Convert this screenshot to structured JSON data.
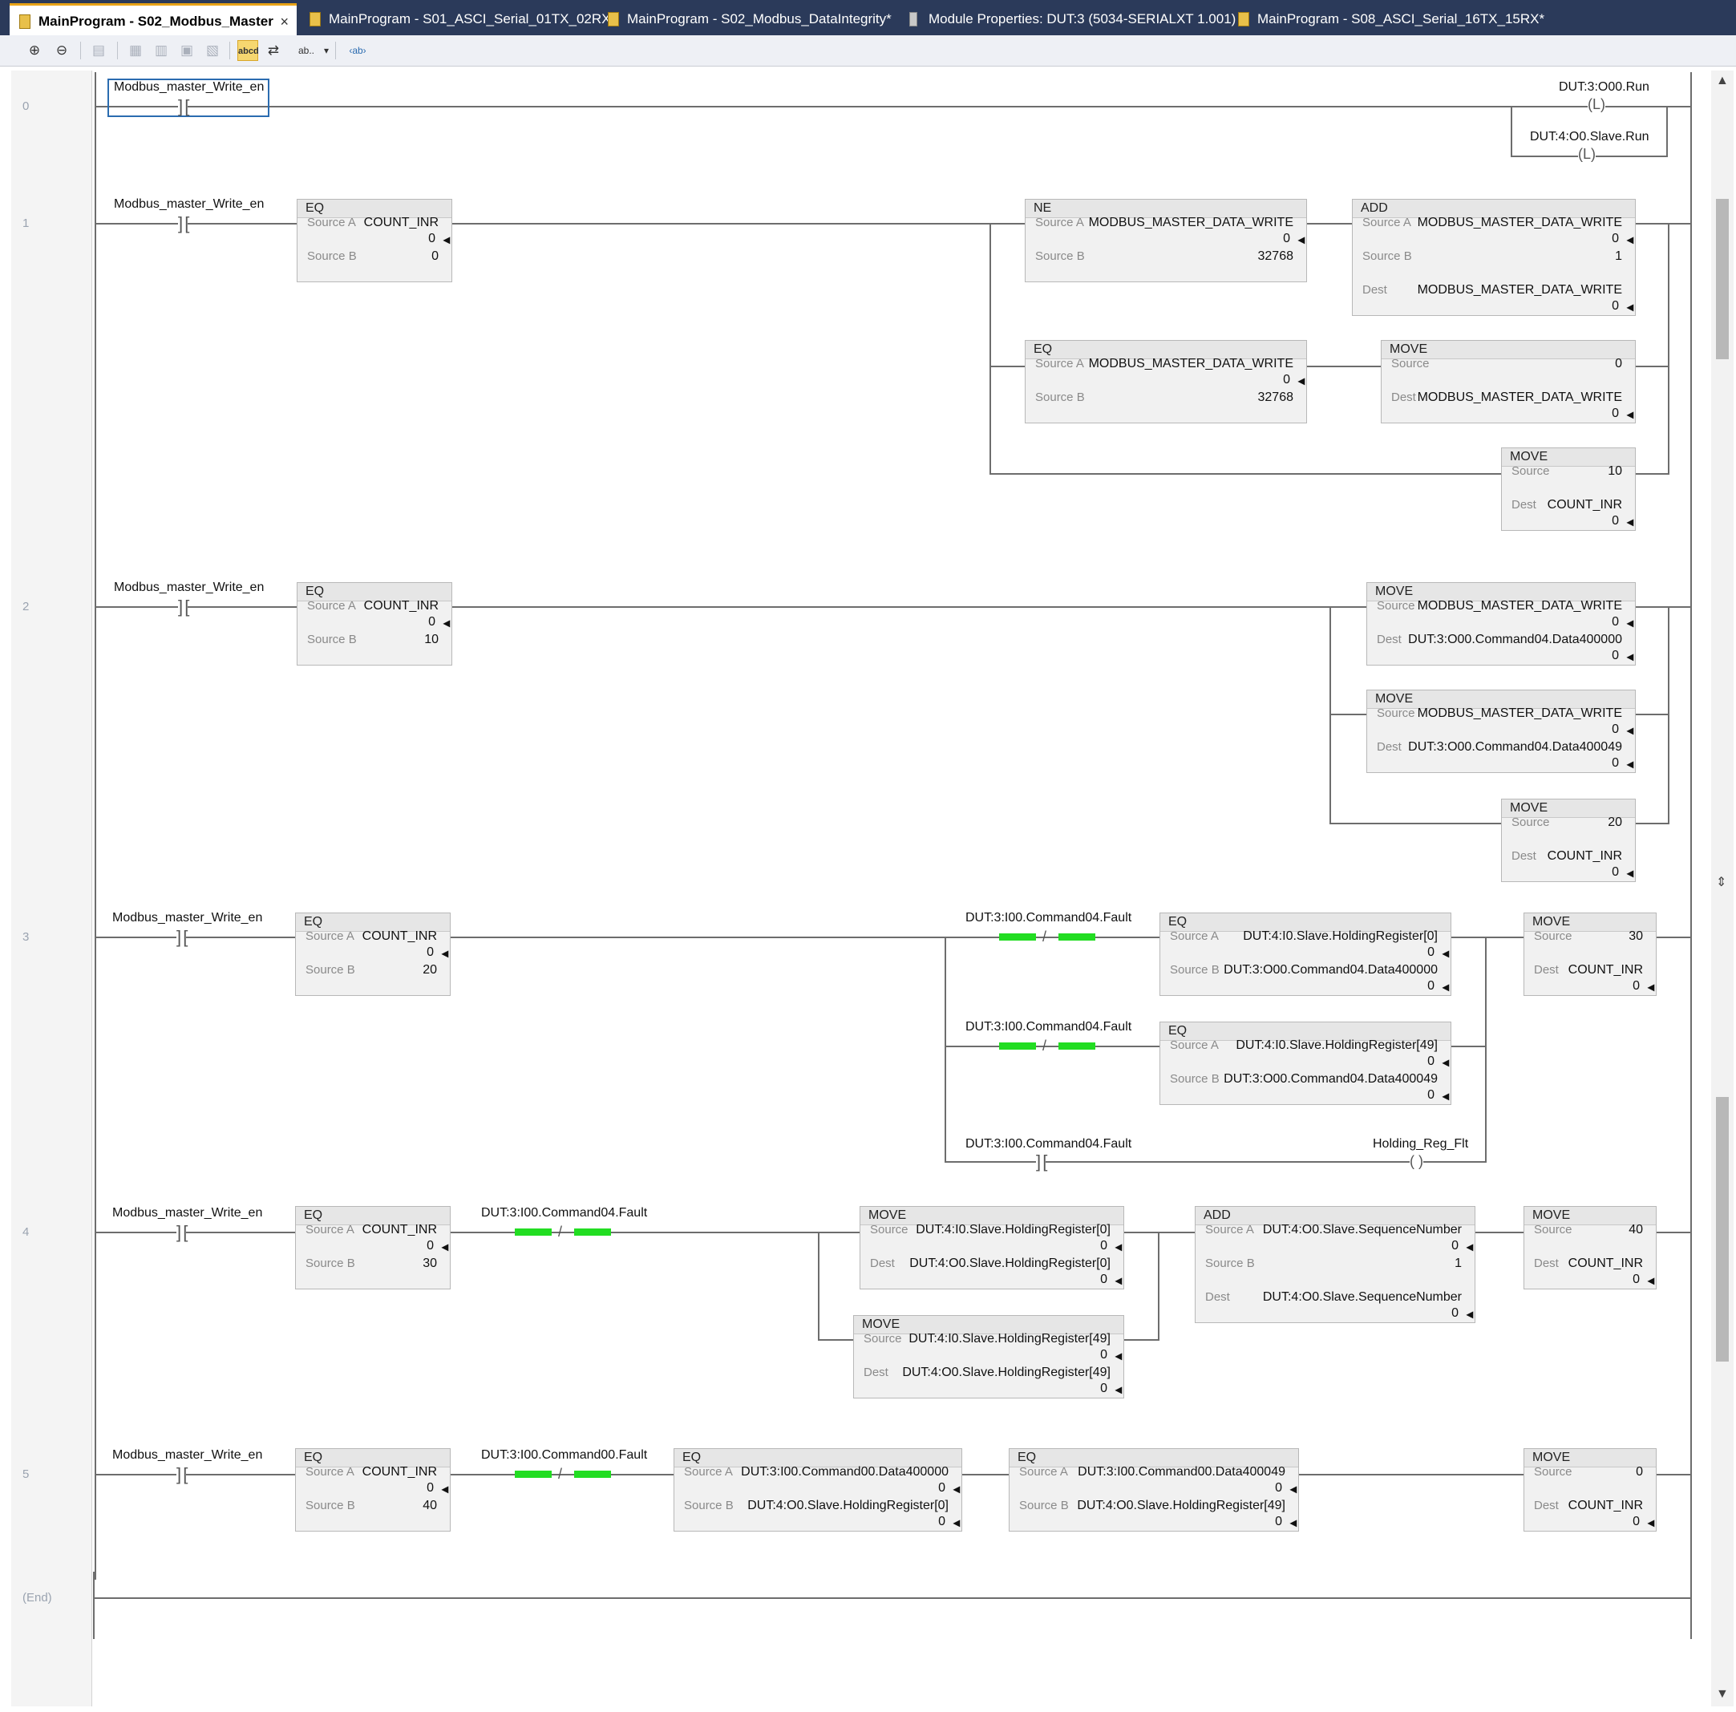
{
  "tabs": [
    {
      "label": "MainProgram - S02_Modbus_Master",
      "active": true,
      "close": "×"
    },
    {
      "label": "MainProgram - S01_ASCI_Serial_01TX_02RX*",
      "active": false
    },
    {
      "label": "MainProgram - S02_Modbus_DataIntegrity*",
      "active": false
    },
    {
      "label": "Module Properties: DUT:3 (5034-SERIALXT 1.001)",
      "active": false
    },
    {
      "label": "MainProgram - S08_ASCI_Serial_16TX_15RX*",
      "active": false
    }
  ],
  "toolbar": {
    "zoom_in": "⊕",
    "zoom_out": "⊖",
    "abcd": "abcd",
    "ab": "ab..",
    "dropdown": "▾",
    "chevron": "‹ab›"
  },
  "rungs": {
    "r0": {
      "num": "0",
      "contact": "Modbus_master_Write_en",
      "coil1": "DUT:3:O00.Run",
      "coil2": "DUT:4:O0.Slave.Run",
      "coil_sym": "(L)"
    },
    "r1": {
      "num": "1",
      "contact": "Modbus_master_Write_en",
      "eq": {
        "title": "EQ",
        "a_lbl": "Source A",
        "a": "COUNT_INR",
        "a_sub": "0",
        "b_lbl": "Source B",
        "b": "0"
      },
      "ne": {
        "title": "NE",
        "a_lbl": "Source A",
        "a": "MODBUS_MASTER_DATA_WRITE",
        "a_sub": "0",
        "b_lbl": "Source B",
        "b": "32768"
      },
      "add": {
        "title": "ADD",
        "a_lbl": "Source A",
        "a": "MODBUS_MASTER_DATA_WRITE",
        "a_sub": "0",
        "b_lbl": "Source B",
        "b": "1",
        "d_lbl": "Dest",
        "d": "MODBUS_MASTER_DATA_WRITE",
        "d_sub": "0"
      },
      "eq2": {
        "title": "EQ",
        "a_lbl": "Source A",
        "a": "MODBUS_MASTER_DATA_WRITE",
        "a_sub": "0",
        "b_lbl": "Source B",
        "b": "32768"
      },
      "mov1": {
        "title": "MOVE",
        "s_lbl": "Source",
        "s": "0",
        "d_lbl": "Dest",
        "d": "MODBUS_MASTER_DATA_WRITE",
        "d_sub": "0"
      },
      "mov2": {
        "title": "MOVE",
        "s_lbl": "Source",
        "s": "10",
        "d_lbl": "Dest",
        "d": "COUNT_INR",
        "d_sub": "0"
      }
    },
    "r2": {
      "num": "2",
      "contact": "Modbus_master_Write_en",
      "eq": {
        "title": "EQ",
        "a_lbl": "Source A",
        "a": "COUNT_INR",
        "a_sub": "0",
        "b_lbl": "Source B",
        "b": "10"
      },
      "mov1": {
        "title": "MOVE",
        "s_lbl": "Source",
        "s": "MODBUS_MASTER_DATA_WRITE",
        "s_sub": "0",
        "d_lbl": "Dest",
        "d": "DUT:3:O00.Command04.Data400000",
        "d_sub": "0"
      },
      "mov2": {
        "title": "MOVE",
        "s_lbl": "Source",
        "s": "MODBUS_MASTER_DATA_WRITE",
        "s_sub": "0",
        "d_lbl": "Dest",
        "d": "DUT:3:O00.Command04.Data400049",
        "d_sub": "0"
      },
      "mov3": {
        "title": "MOVE",
        "s_lbl": "Source",
        "s": "20",
        "d_lbl": "Dest",
        "d": "COUNT_INR",
        "d_sub": "0"
      }
    },
    "r3": {
      "num": "3",
      "contact": "Modbus_master_Write_en",
      "eq": {
        "title": "EQ",
        "a_lbl": "Source A",
        "a": "COUNT_INR",
        "a_sub": "0",
        "b_lbl": "Source B",
        "b": "20"
      },
      "fault1": "DUT:3:I00.Command04.Fault",
      "fault2": "DUT:3:I00.Command04.Fault",
      "fault3": "DUT:3:I00.Command04.Fault",
      "eq2": {
        "title": "EQ",
        "a_lbl": "Source A",
        "a": "DUT:4:I0.Slave.HoldingRegister[0]",
        "a_sub": "0",
        "b_lbl": "Source B",
        "b": "DUT:3:O00.Command04.Data400000",
        "b_sub": "0"
      },
      "eq3": {
        "title": "EQ",
        "a_lbl": "Source A",
        "a": "DUT:4:I0.Slave.HoldingRegister[49]",
        "a_sub": "0",
        "b_lbl": "Source B",
        "b": "DUT:3:O00.Command04.Data400049",
        "b_sub": "0"
      },
      "mov": {
        "title": "MOVE",
        "s_lbl": "Source",
        "s": "30",
        "d_lbl": "Dest",
        "d": "COUNT_INR",
        "d_sub": "0"
      },
      "coil": "Holding_Reg_Flt",
      "coil_sym": "( )"
    },
    "r4": {
      "num": "4",
      "contact": "Modbus_master_Write_en",
      "fault": "DUT:3:I00.Command04.Fault",
      "eq": {
        "title": "EQ",
        "a_lbl": "Source A",
        "a": "COUNT_INR",
        "a_sub": "0",
        "b_lbl": "Source B",
        "b": "30"
      },
      "mov1": {
        "title": "MOVE",
        "s_lbl": "Source",
        "s": "DUT:4:I0.Slave.HoldingRegister[0]",
        "s_sub": "0",
        "d_lbl": "Dest",
        "d": "DUT:4:O0.Slave.HoldingRegister[0]",
        "d_sub": "0"
      },
      "mov2": {
        "title": "MOVE",
        "s_lbl": "Source",
        "s": "DUT:4:I0.Slave.HoldingRegister[49]",
        "s_sub": "0",
        "d_lbl": "Dest",
        "d": "DUT:4:O0.Slave.HoldingRegister[49]",
        "d_sub": "0"
      },
      "add": {
        "title": "ADD",
        "a_lbl": "Source A",
        "a": "DUT:4:O0.Slave.SequenceNumber",
        "a_sub": "0",
        "b_lbl": "Source B",
        "b": "1",
        "d_lbl": "Dest",
        "d": "DUT:4:O0.Slave.SequenceNumber",
        "d_sub": "0"
      },
      "mov3": {
        "title": "MOVE",
        "s_lbl": "Source",
        "s": "40",
        "d_lbl": "Dest",
        "d": "COUNT_INR",
        "d_sub": "0"
      }
    },
    "r5": {
      "num": "5",
      "contact": "Modbus_master_Write_en",
      "fault": "DUT:3:I00.Command00.Fault",
      "eq": {
        "title": "EQ",
        "a_lbl": "Source A",
        "a": "COUNT_INR",
        "a_sub": "0",
        "b_lbl": "Source B",
        "b": "40"
      },
      "eq2": {
        "title": "EQ",
        "a_lbl": "Source A",
        "a": "DUT:3:I00.Command00.Data400000",
        "a_sub": "0",
        "b_lbl": "Source B",
        "b": "DUT:4:O0.Slave.HoldingRegister[0]",
        "b_sub": "0"
      },
      "eq3": {
        "title": "EQ",
        "a_lbl": "Source A",
        "a": "DUT:3:I00.Command00.Data400049",
        "a_sub": "0",
        "b_lbl": "Source B",
        "b": "DUT:4:O0.Slave.HoldingRegister[49]",
        "b_sub": "0"
      },
      "mov": {
        "title": "MOVE",
        "s_lbl": "Source",
        "s": "0",
        "d_lbl": "Dest",
        "d": "COUNT_INR",
        "d_sub": "0"
      }
    },
    "end": "(End)"
  },
  "symbols": {
    "no_contact": "] [",
    "nc_slash": "/",
    "arrow": "◂"
  },
  "colors": {
    "tabbar": "#2b3a5a",
    "active_tab_accent": "#e8a317",
    "forced_green": "#22dd22",
    "arrow_blue": "#1f3fd1"
  }
}
